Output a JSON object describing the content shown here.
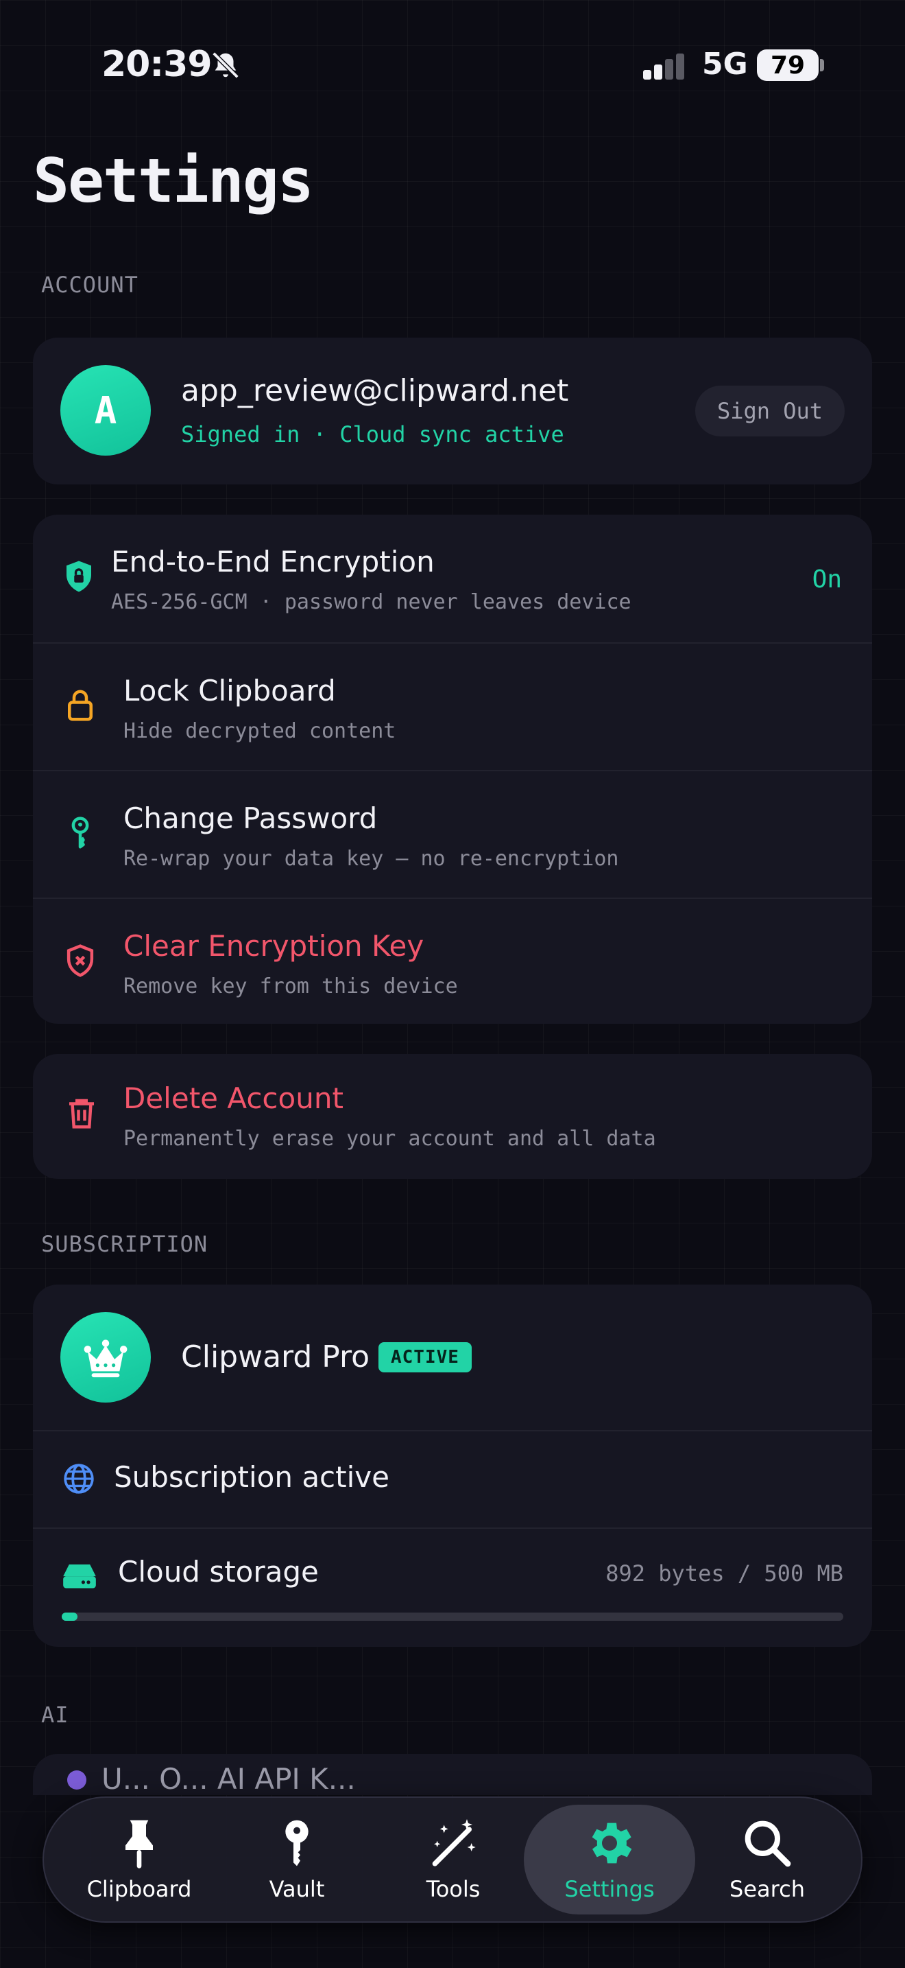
{
  "status_bar": {
    "time": "20:39",
    "network": "5G",
    "battery": "79"
  },
  "page": {
    "title": "Settings"
  },
  "account": {
    "section_label": "ACCOUNT",
    "avatar_letter": "A",
    "email": "app_review@clipward.net",
    "status": "Signed in · Cloud sync active",
    "sign_out_label": "Sign Out"
  },
  "security": {
    "rows": [
      {
        "title": "End-to-End Encryption",
        "subtitle": "AES-256-GCM · password never leaves device",
        "value": "On",
        "icon": "shield-lock-icon"
      },
      {
        "title": "Lock Clipboard",
        "subtitle": "Hide decrypted content",
        "icon": "lock-icon"
      },
      {
        "title": "Change Password",
        "subtitle": "Re-wrap your data key — no re-encryption",
        "icon": "key-icon"
      },
      {
        "title": "Clear Encryption Key",
        "subtitle": "Remove key from this device",
        "icon": "shield-x-icon"
      }
    ]
  },
  "danger": {
    "title": "Delete Account",
    "subtitle": "Permanently erase your account and all data",
    "icon": "trash-icon"
  },
  "subscription": {
    "section_label": "SUBSCRIPTION",
    "plan_name": "Clipward Pro",
    "badge": "ACTIVE",
    "status_label": "Subscription active",
    "storage_label": "Cloud storage",
    "storage_value": "892 bytes / 500 MB",
    "storage_fraction": 0.02
  },
  "ai": {
    "section_label": "AI",
    "partial_row": "U... O... AI API K..."
  },
  "tabbar": {
    "tabs": [
      {
        "label": "Clipboard",
        "icon": "pin-icon"
      },
      {
        "label": "Vault",
        "icon": "key-icon"
      },
      {
        "label": "Tools",
        "icon": "magic-wand-icon"
      },
      {
        "label": "Settings",
        "icon": "gear-icon",
        "active": true
      },
      {
        "label": "Search",
        "icon": "search-icon"
      }
    ]
  },
  "colors": {
    "accent": "#22d3a6",
    "danger": "#f2566b",
    "warning": "#f5a524",
    "card": "#161622",
    "background": "#0c0c14"
  }
}
